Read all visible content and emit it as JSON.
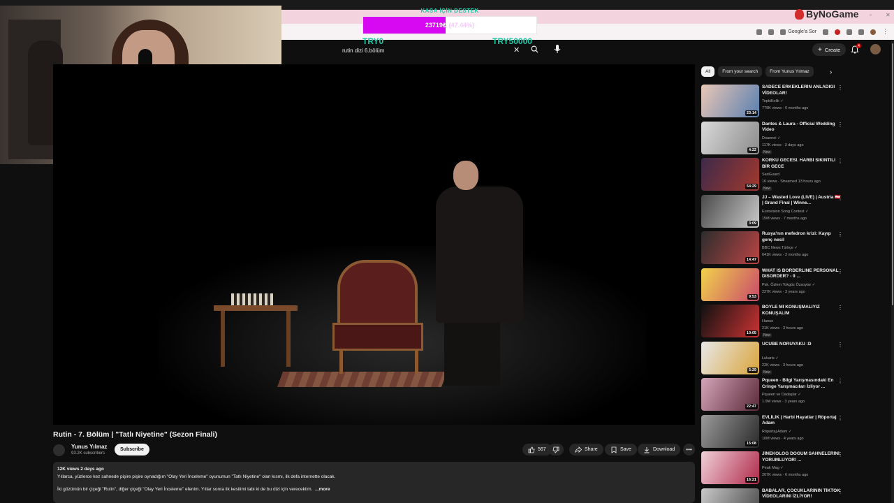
{
  "browser": {
    "search_chip": "Google'a Sor"
  },
  "donation": {
    "title": "KASA İÇİN DESTEK",
    "amount": "23719₺",
    "percent_text": "(47.44%)",
    "progress_fraction": 0.4744,
    "min_label": "TRY0",
    "max_label": "TRY50000"
  },
  "brand": {
    "name": "ByNoGame"
  },
  "header": {
    "search_value": "rutin dizi 6.bölüm",
    "create_label": "Create",
    "notification_count": "4"
  },
  "video": {
    "title": "Rutin - 7. Bölüm | \"Tatlı Niyetine\" (Sezon Finali)",
    "channel": "Yunus Yılmaz",
    "subscribers": "93.2K subscribers",
    "subscribe_label": "Subscribe",
    "likes": "567",
    "share_label": "Share",
    "save_label": "Save",
    "download_label": "Download",
    "more_label": "•••",
    "views_date": "12K views  2 days ago",
    "description_line1": "Yıllarca, yüzlerce kez sahnede pişire pişire oynadığım \"Olay Yeri İnceleme\" oyunumun \"Tatlı Niyetine\" olan kısmı, ilk defa internette olacak.",
    "description_line2": "İki gözümün bir çiçeği \"Rutin\", diğer çiçeği \"Olay Yeri İnceleme\" efenim. Yıllar sonra ilk kesitimi tabi ki de bu dizi için verecektim.",
    "more_link": "...more"
  },
  "sidebar": {
    "chips": [
      "All",
      "From your search",
      "From Yunus Yılmaz"
    ],
    "recommendations": [
      {
        "title": "SADECE ERKEKLERİN ANLADIĞI VİDEOLAR!",
        "channel": "TepkiKolik ✓",
        "meta": "779K views · 6 months ago",
        "duration": "23:14",
        "new": ""
      },
      {
        "title": "Dantes & Laura - Official Wedding Video",
        "channel": "Doaenei ✓",
        "meta": "117K views · 3 days ago",
        "duration": "4:22",
        "new": "New"
      },
      {
        "title": "KORKU GECESİ. HARBİ SIKINTILI BİR GECE",
        "channel": "SariGuard",
        "meta": "16 views · Streamed 13 hours ago",
        "duration": "54:29",
        "new": "New"
      },
      {
        "title": "JJ – Wasted Love (LIVE) | Austria 🇦🇹 | Grand Final | Winne...",
        "channel": "Eurovision Song Contest ✓",
        "meta": "15M views · 7 months ago",
        "duration": "3:09",
        "new": ""
      },
      {
        "title": "Rusya'nın mefedron krizi: Kayıp genç nesil",
        "channel": "BBC News Türkçe ✓",
        "meta": "641K views · 2 months ago",
        "duration": "14:47",
        "new": ""
      },
      {
        "title": "WHAT IS BORDERLINE PERSONAL DISORDER? - 9 ...",
        "channel": "Psk. Özlem Tokgöz Özsoylar ✓",
        "meta": "227K views · 3 years ago",
        "duration": "9:53",
        "new": ""
      },
      {
        "title": "BÖYLE Mİ KONUŞMALIYIZ KONUŞALIM",
        "channel": "Hanuo",
        "meta": "21K views · 3 hours ago",
        "duration": "10:05",
        "new": "New"
      },
      {
        "title": "UCUBE NORUYAKU :D",
        "channel": "Lukaris ✓",
        "meta": "22K views · 3 hours ago",
        "duration": "5:29",
        "new": "New"
      },
      {
        "title": "Pqueen - Bilgi Yarışmasındaki En Cringe Yarışmacıları İzliyor ...",
        "channel": "Pqueen ve Dadaşlar ✓",
        "meta": "1.9M views · 3 years ago",
        "duration": "22:47",
        "new": ""
      },
      {
        "title": "EVLİLİK | Harbi Hayatlar | Röportaj Adam",
        "channel": "Röportaj Adam ✓",
        "meta": "10M views · 4 years ago",
        "duration": "15:08",
        "new": ""
      },
      {
        "title": "JİNEKOLOG DOĞUM SAHNELERİNİ YORUMLUYOR! ...",
        "channel": "Peak Mag ✓",
        "meta": "207K views · 6 months ago",
        "duration": "16:21",
        "new": ""
      },
      {
        "title": "BABALAR, ÇOCUKLARININ TİKTOK VİDEOLARINI İZLİYOR!",
        "channel": "",
        "meta": "",
        "duration": "",
        "new": ""
      }
    ]
  },
  "colors": {
    "accent": "#d708f2",
    "donation_text": "#1ec9a6",
    "background": "#0f0f0f"
  }
}
